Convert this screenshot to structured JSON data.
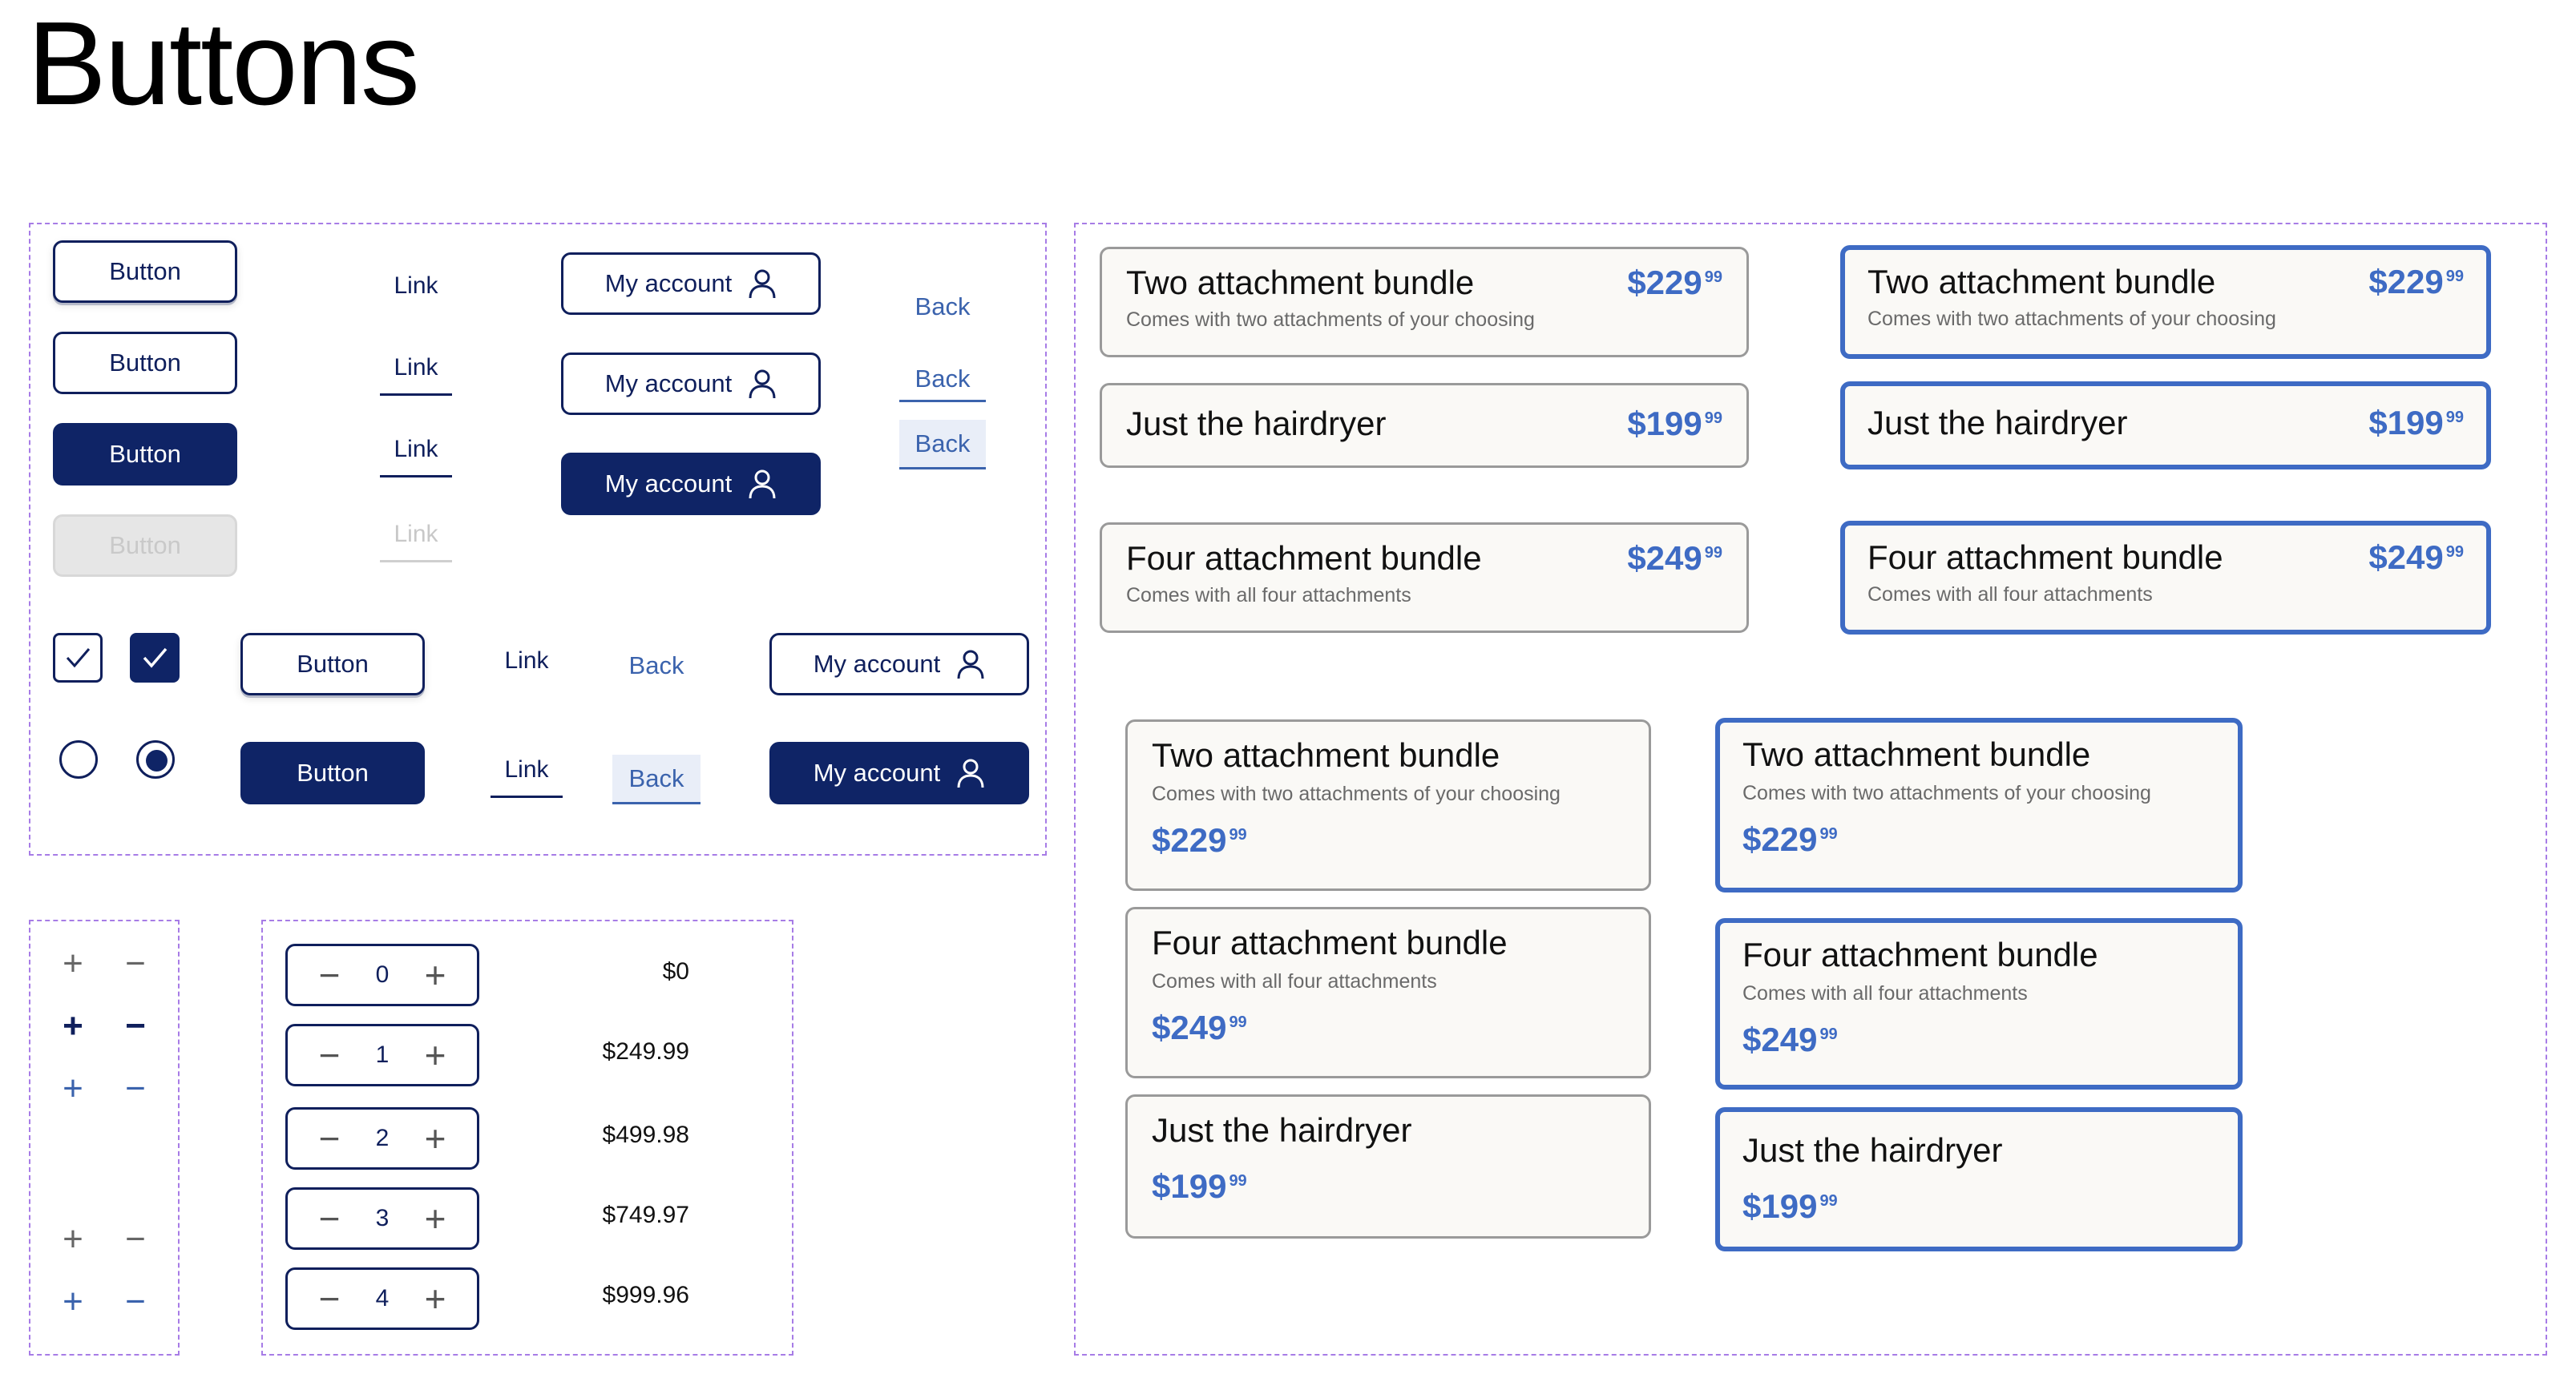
{
  "page": {
    "title": "Buttons"
  },
  "colors": {
    "navy": "#0f2466",
    "accent": "#3e6bc4",
    "dashed_frame": "#a77ce6",
    "disabled": "#e6e6e6"
  },
  "buttons": {
    "button_label": "Button",
    "link_label": "Link",
    "back_label": "Back",
    "account_label": "My account",
    "account_icon": "user-icon",
    "check_icon": "check-icon",
    "radio_icon": "radio-dot-icon"
  },
  "qty_icons": {
    "plus": "+",
    "minus": "−"
  },
  "steppers": [
    {
      "qty": "0",
      "total": "$0"
    },
    {
      "qty": "1",
      "total": "$249.99"
    },
    {
      "qty": "2",
      "total": "$499.98"
    },
    {
      "qty": "3",
      "total": "$749.97"
    },
    {
      "qty": "4",
      "total": "$999.96"
    }
  ],
  "products": {
    "two": {
      "name": "Two attachment bundle",
      "desc": "Comes with two attachments of your choosing",
      "price": "$229",
      "cents": "99"
    },
    "four": {
      "name": "Four attachment bundle",
      "desc": "Comes with all four attachments",
      "price": "$249",
      "cents": "99"
    },
    "hair": {
      "name": "Just the hairdryer",
      "desc": "",
      "price": "$199",
      "cents": "99"
    }
  }
}
